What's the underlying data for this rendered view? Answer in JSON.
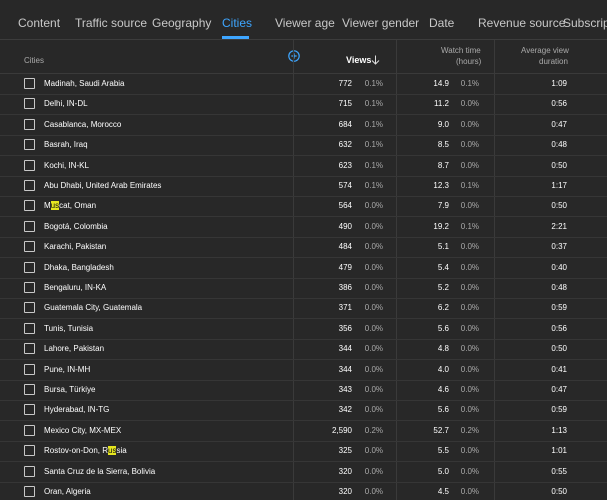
{
  "tabs": [
    {
      "label": "Content"
    },
    {
      "label": "Traffic source"
    },
    {
      "label": "Geography"
    },
    {
      "label": "Cities"
    },
    {
      "label": "Viewer age"
    },
    {
      "label": "Viewer gender"
    },
    {
      "label": "Date"
    },
    {
      "label": "Revenue source"
    },
    {
      "label": "Subscriptio"
    }
  ],
  "active_tab": "Cities",
  "table": {
    "headers": {
      "cities": "Cities",
      "views": "Views",
      "watch_time_line1": "Watch time",
      "watch_time_line2": "(hours)",
      "avg_line1": "Average view",
      "avg_line2": "duration"
    },
    "rows": [
      {
        "city": "Madinah, Saudi Arabia",
        "views": "772",
        "views_pct": "0.1%",
        "watch": "14.9",
        "watch_pct": "0.1%",
        "avg": "1:09"
      },
      {
        "city": "Delhi, IN-DL",
        "views": "715",
        "views_pct": "0.1%",
        "watch": "11.2",
        "watch_pct": "0.0%",
        "avg": "0:56"
      },
      {
        "city": "Casablanca, Morocco",
        "views": "684",
        "views_pct": "0.1%",
        "watch": "9.0",
        "watch_pct": "0.0%",
        "avg": "0:47"
      },
      {
        "city": "Basrah, Iraq",
        "views": "632",
        "views_pct": "0.1%",
        "watch": "8.5",
        "watch_pct": "0.0%",
        "avg": "0:48"
      },
      {
        "city": "Kochi, IN-KL",
        "views": "623",
        "views_pct": "0.1%",
        "watch": "8.7",
        "watch_pct": "0.0%",
        "avg": "0:50"
      },
      {
        "city": "Abu Dhabi, United Arab Emirates",
        "views": "574",
        "views_pct": "0.1%",
        "watch": "12.3",
        "watch_pct": "0.1%",
        "avg": "1:17"
      },
      {
        "city_pre": "M",
        "city_hl": "us",
        "city_post": "cat, Oman",
        "views": "564",
        "views_pct": "0.0%",
        "watch": "7.9",
        "watch_pct": "0.0%",
        "avg": "0:50"
      },
      {
        "city": "Bogotá, Colombia",
        "views": "490",
        "views_pct": "0.0%",
        "watch": "19.2",
        "watch_pct": "0.1%",
        "avg": "2:21"
      },
      {
        "city": "Karachi, Pakistan",
        "views": "484",
        "views_pct": "0.0%",
        "watch": "5.1",
        "watch_pct": "0.0%",
        "avg": "0:37"
      },
      {
        "city": "Dhaka, Bangladesh",
        "views": "479",
        "views_pct": "0.0%",
        "watch": "5.4",
        "watch_pct": "0.0%",
        "avg": "0:40"
      },
      {
        "city": "Bengaluru, IN-KA",
        "views": "386",
        "views_pct": "0.0%",
        "watch": "5.2",
        "watch_pct": "0.0%",
        "avg": "0:48"
      },
      {
        "city": "Guatemala City, Guatemala",
        "views": "371",
        "views_pct": "0.0%",
        "watch": "6.2",
        "watch_pct": "0.0%",
        "avg": "0:59"
      },
      {
        "city": "Tunis, Tunisia",
        "views": "356",
        "views_pct": "0.0%",
        "watch": "5.6",
        "watch_pct": "0.0%",
        "avg": "0:56"
      },
      {
        "city": "Lahore, Pakistan",
        "views": "344",
        "views_pct": "0.0%",
        "watch": "4.8",
        "watch_pct": "0.0%",
        "avg": "0:50"
      },
      {
        "city": "Pune, IN-MH",
        "views": "344",
        "views_pct": "0.0%",
        "watch": "4.0",
        "watch_pct": "0.0%",
        "avg": "0:41"
      },
      {
        "city": "Bursa, Türkiye",
        "views": "343",
        "views_pct": "0.0%",
        "watch": "4.6",
        "watch_pct": "0.0%",
        "avg": "0:47"
      },
      {
        "city": "Hyderabad, IN-TG",
        "views": "342",
        "views_pct": "0.0%",
        "watch": "5.6",
        "watch_pct": "0.0%",
        "avg": "0:59"
      },
      {
        "city": "Mexico City, MX-MEX",
        "views": "2,590",
        "views_pct": "0.2%",
        "watch": "52.7",
        "watch_pct": "0.2%",
        "avg": "1:13"
      },
      {
        "city_pre": "Rostov-on-Don, R",
        "city_hl": "us",
        "city_post": "sia",
        "views": "325",
        "views_pct": "0.0%",
        "watch": "5.5",
        "watch_pct": "0.0%",
        "avg": "1:01"
      },
      {
        "city": "Santa Cruz de la Sierra, Bolivia",
        "views": "320",
        "views_pct": "0.0%",
        "watch": "5.0",
        "watch_pct": "0.0%",
        "avg": "0:55"
      },
      {
        "city": "Oran, Algeria",
        "views": "320",
        "views_pct": "0.0%",
        "watch": "4.5",
        "watch_pct": "0.0%",
        "avg": "0:50"
      }
    ]
  },
  "colors": {
    "background": "#282828",
    "accent": "#3ea6ff",
    "highlight": "#e6e61f"
  }
}
